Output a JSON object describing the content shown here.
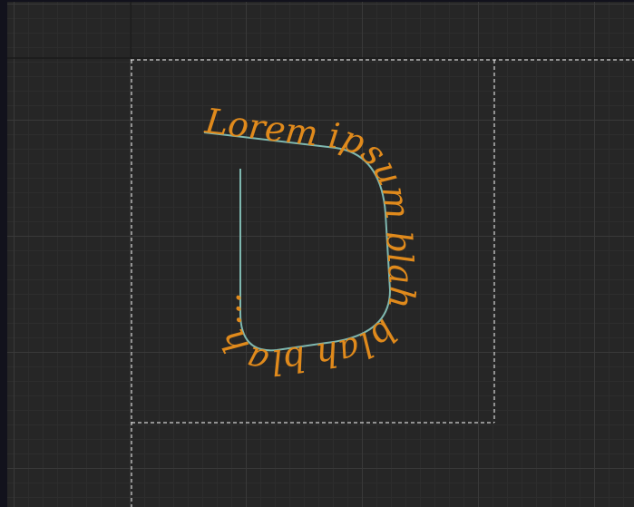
{
  "canvas": {
    "background_color": "#262626",
    "grid_major_color": "#393939",
    "grid_minor_color": "#2d2d2d",
    "frame_color": "#ffffff",
    "frame_style": "dashed"
  },
  "text_on_path": {
    "text": "Lorem ipsum blah blah blah...",
    "text_color": "#e08a1c",
    "path_color": "#7fb8b0"
  }
}
